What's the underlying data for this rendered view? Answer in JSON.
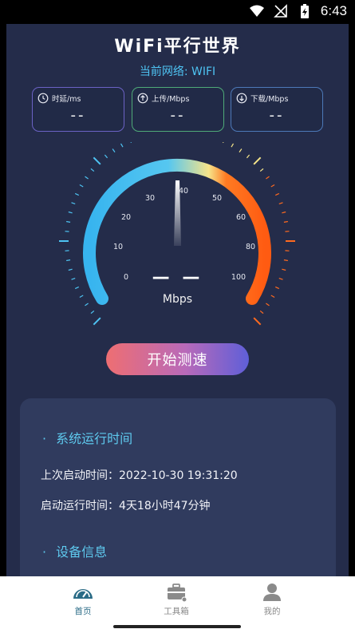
{
  "status_bar": {
    "time": "6:43",
    "icons": [
      "wifi-icon",
      "no-signal-icon",
      "battery-charging-icon"
    ]
  },
  "header": {
    "title": "WiFi平行世界",
    "network": "当前网络: WIFI"
  },
  "metrics": [
    {
      "label": "时延/ms",
      "value": "--",
      "icon": "clock-icon"
    },
    {
      "label": "上传/Mbps",
      "value": "--",
      "icon": "upload-icon"
    },
    {
      "label": "下载/Mbps",
      "value": "--",
      "icon": "download-icon"
    }
  ],
  "gauge": {
    "speed": "— —",
    "unit": "Mbps",
    "scale_labels": [
      "0",
      "10",
      "20",
      "30",
      "40",
      "50",
      "60",
      "80",
      "100"
    ],
    "needle_value": "40",
    "colors": {
      "start": "#4ec3f2",
      "mid": "#f5e58a",
      "end": "#ff6a1f"
    }
  },
  "actions": {
    "start_test": "开始测速"
  },
  "system_card": {
    "section1_title": "系统运行时间",
    "last_boot_label": "上次启动时间：",
    "last_boot_value": "2022-10-30 19:31:20",
    "uptime_label": "启动运行时间：",
    "uptime_value": "4天18小时47分钟",
    "section2_title": "设备信息"
  },
  "nav": [
    {
      "label": "首页",
      "icon": "speedometer-icon",
      "active": true
    },
    {
      "label": "工具箱",
      "icon": "toolbox-icon",
      "active": false
    },
    {
      "label": "我的",
      "icon": "user-icon",
      "active": false
    }
  ],
  "colors": {
    "background": "#242c4a",
    "card": "#303b5e",
    "accent": "#4ec3f2",
    "active_tab": "#2a6b86"
  }
}
